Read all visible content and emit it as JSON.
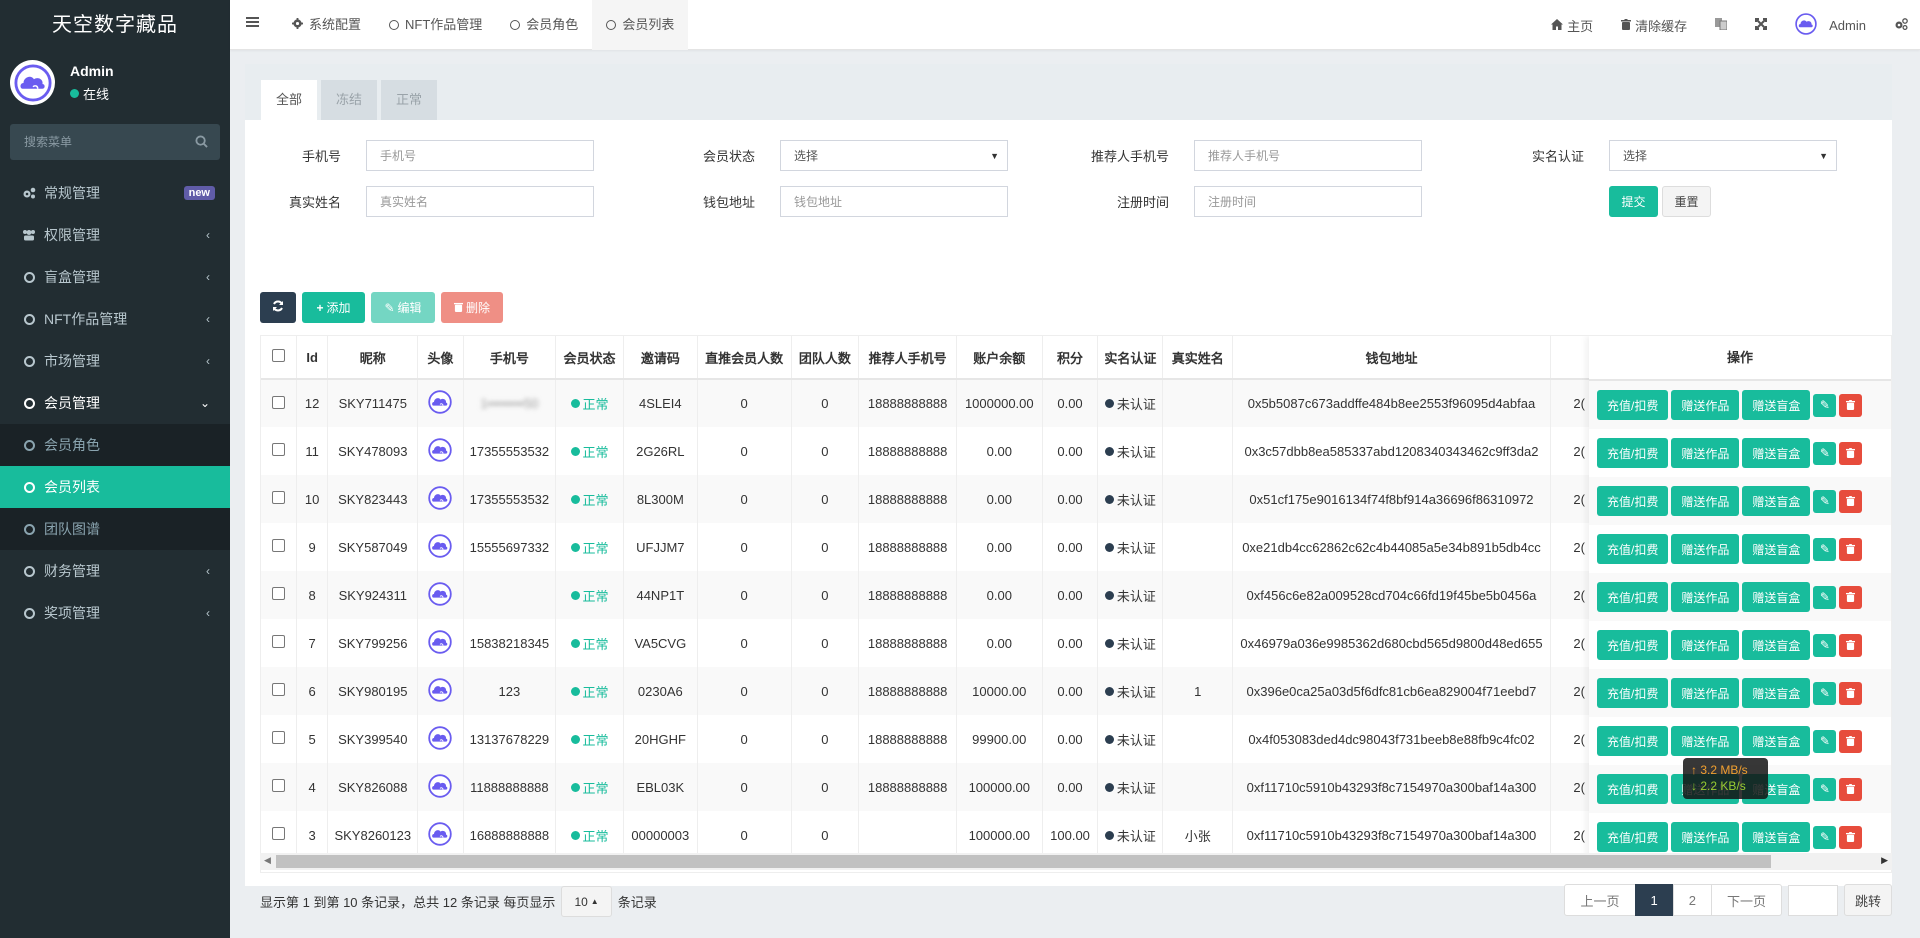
{
  "app": {
    "title": "天空数字藏品"
  },
  "user": {
    "name": "Admin",
    "status": "在线",
    "status_color": "#00a65a"
  },
  "sidebar": {
    "search_placeholder": "搜索菜单",
    "items": [
      {
        "label": "常规管理",
        "icon": "cogs-icon",
        "badge": "new"
      },
      {
        "label": "权限管理",
        "icon": "users-icon"
      },
      {
        "label": "盲盒管理",
        "icon": "circle-icon"
      },
      {
        "label": "NFT作品管理",
        "icon": "circle-icon"
      },
      {
        "label": "市场管理",
        "icon": "circle-icon"
      },
      {
        "label": "会员管理",
        "icon": "circle-icon",
        "open": true
      },
      {
        "label": "财务管理",
        "icon": "circle-icon"
      },
      {
        "label": "奖项管理",
        "icon": "circle-icon"
      }
    ],
    "subitems": [
      {
        "label": "会员角色"
      },
      {
        "label": "会员列表",
        "active": true
      },
      {
        "label": "团队图谱"
      }
    ]
  },
  "topbar": {
    "tabs": [
      {
        "label": "系统配置",
        "icon": "gear-icon"
      },
      {
        "label": "NFT作品管理",
        "icon": "circle-icon"
      },
      {
        "label": "会员角色",
        "icon": "circle-icon"
      },
      {
        "label": "会员列表",
        "icon": "circle-icon",
        "active": true
      }
    ],
    "home": "主页",
    "clear_cache": "清除缓存",
    "user": "Admin"
  },
  "content_tabs": [
    "全部",
    "冻结",
    "正常"
  ],
  "filters": {
    "phone": {
      "label": "手机号",
      "placeholder": "手机号"
    },
    "status": {
      "label": "会员状态",
      "value": "选择"
    },
    "ref_phone": {
      "label": "推荐人手机号",
      "placeholder": "推荐人手机号"
    },
    "realname_auth": {
      "label": "实名认证",
      "value": "选择"
    },
    "realname": {
      "label": "真实姓名",
      "placeholder": "真实姓名"
    },
    "wallet": {
      "label": "钱包地址",
      "placeholder": "钱包地址"
    },
    "regtime": {
      "label": "注册时间",
      "placeholder": "注册时间"
    },
    "submit": "提交",
    "reset": "重置"
  },
  "toolbar": {
    "add": "添加",
    "edit": "编辑",
    "delete": "删除"
  },
  "table": {
    "headers": [
      "Id",
      "昵称",
      "头像",
      "手机号",
      "会员状态",
      "邀请码",
      "直推会员人数",
      "团队人数",
      "推荐人手机号",
      "账户余额",
      "积分",
      "实名认证",
      "真实姓名",
      "钱包地址",
      "",
      "操作"
    ],
    "action_labels": {
      "recharge": "充值/扣费",
      "gift_work": "赠送作品",
      "gift_box": "赠送盲盒"
    },
    "status_color": "#18bc9c",
    "auth_color": "#2c3e50",
    "rows": [
      {
        "id": "12",
        "nick": "SKY711475",
        "phone": "1••••••••50",
        "status": "正常",
        "invite": "4SLEI4",
        "direct": "0",
        "team": "0",
        "ref": "18888888888",
        "balance": "1000000.00",
        "points": "0.00",
        "auth": "未认证",
        "realname": "",
        "wallet": "0x5b5087c673addffe484b8ee2553f96095d4abfaa",
        "extra": "2("
      },
      {
        "id": "11",
        "nick": "SKY478093",
        "phone": "17355553532",
        "status": "正常",
        "invite": "2G26RL",
        "direct": "0",
        "team": "0",
        "ref": "18888888888",
        "balance": "0.00",
        "points": "0.00",
        "auth": "未认证",
        "realname": "",
        "wallet": "0x3c57dbb8ea585337abd1208340343462c9ff3da2",
        "extra": "2("
      },
      {
        "id": "10",
        "nick": "SKY823443",
        "phone": "17355553532",
        "status": "正常",
        "invite": "8L300M",
        "direct": "0",
        "team": "0",
        "ref": "18888888888",
        "balance": "0.00",
        "points": "0.00",
        "auth": "未认证",
        "realname": "",
        "wallet": "0x51cf175e9016134f74f8bf914a36696f86310972",
        "extra": "2("
      },
      {
        "id": "9",
        "nick": "SKY587049",
        "phone": "15555697332",
        "status": "正常",
        "invite": "UFJJM7",
        "direct": "0",
        "team": "0",
        "ref": "18888888888",
        "balance": "0.00",
        "points": "0.00",
        "auth": "未认证",
        "realname": "",
        "wallet": "0xe21db4cc62862c62c4b44085a5e34b891b5db4cc",
        "extra": "2("
      },
      {
        "id": "8",
        "nick": "SKY924311",
        "phone": "",
        "status": "正常",
        "invite": "44NP1T",
        "direct": "0",
        "team": "0",
        "ref": "18888888888",
        "balance": "0.00",
        "points": "0.00",
        "auth": "未认证",
        "realname": "",
        "wallet": "0xf456c6e82a009528cd704c66fd19f45be5b0456a",
        "extra": "2("
      },
      {
        "id": "7",
        "nick": "SKY799256",
        "phone": "15838218345",
        "status": "正常",
        "invite": "VA5CVG",
        "direct": "0",
        "team": "0",
        "ref": "18888888888",
        "balance": "0.00",
        "points": "0.00",
        "auth": "未认证",
        "realname": "",
        "wallet": "0x46979a036e9985362d680cbd565d9800d48ed655",
        "extra": "2("
      },
      {
        "id": "6",
        "nick": "SKY980195",
        "phone": "123",
        "status": "正常",
        "invite": "0230A6",
        "direct": "0",
        "team": "0",
        "ref": "18888888888",
        "balance": "10000.00",
        "points": "0.00",
        "auth": "未认证",
        "realname": "1",
        "wallet": "0x396e0ca25a03d5f6dfc81cb6ea829004f71eebd7",
        "extra": "2("
      },
      {
        "id": "5",
        "nick": "SKY399540",
        "phone": "13137678229",
        "status": "正常",
        "invite": "20HGHF",
        "direct": "0",
        "team": "0",
        "ref": "18888888888",
        "balance": "99900.00",
        "points": "0.00",
        "auth": "未认证",
        "realname": "",
        "wallet": "0x4f053083ded4dc98043f731beeb8e88fb9c4fc02",
        "extra": "2("
      },
      {
        "id": "4",
        "nick": "SKY826088",
        "phone": "11888888888",
        "status": "正常",
        "invite": "EBL03K",
        "direct": "0",
        "team": "0",
        "ref": "18888888888",
        "balance": "100000.00",
        "points": "0.00",
        "auth": "未认证",
        "realname": "",
        "wallet": "0xf11710c5910b43293f8c7154970a300baf14a300",
        "extra": "2("
      },
      {
        "id": "3",
        "nick": "SKY8260123",
        "phone": "16888888888",
        "status": "正常",
        "invite": "00000003",
        "direct": "0",
        "team": "0",
        "ref": "",
        "balance": "100000.00",
        "points": "100.00",
        "auth": "未认证",
        "realname": "小张",
        "wallet": "0xf11710c5910b43293f8c7154970a300baf14a300",
        "extra": "2("
      }
    ]
  },
  "footer": {
    "info": "显示第 1 到第 10 条记录，总共 12 条记录 每页显示",
    "page_size": "10",
    "suffix": "条记录",
    "prev": "上一页",
    "pages": [
      "1",
      "2"
    ],
    "current_page": "1",
    "next": "下一页",
    "jump": "跳转",
    "jump_value": ""
  },
  "speed_overlay": {
    "up": "↑ 3.2 MB/s",
    "down": "↓ 2.2 KB/s"
  },
  "colors": {
    "primary": "#18bc9c",
    "danger": "#e74c3c",
    "dark": "#2c3e50",
    "sidebar": "#222d32",
    "badge": "#605ca8",
    "avatar": "#6a5cf0"
  }
}
